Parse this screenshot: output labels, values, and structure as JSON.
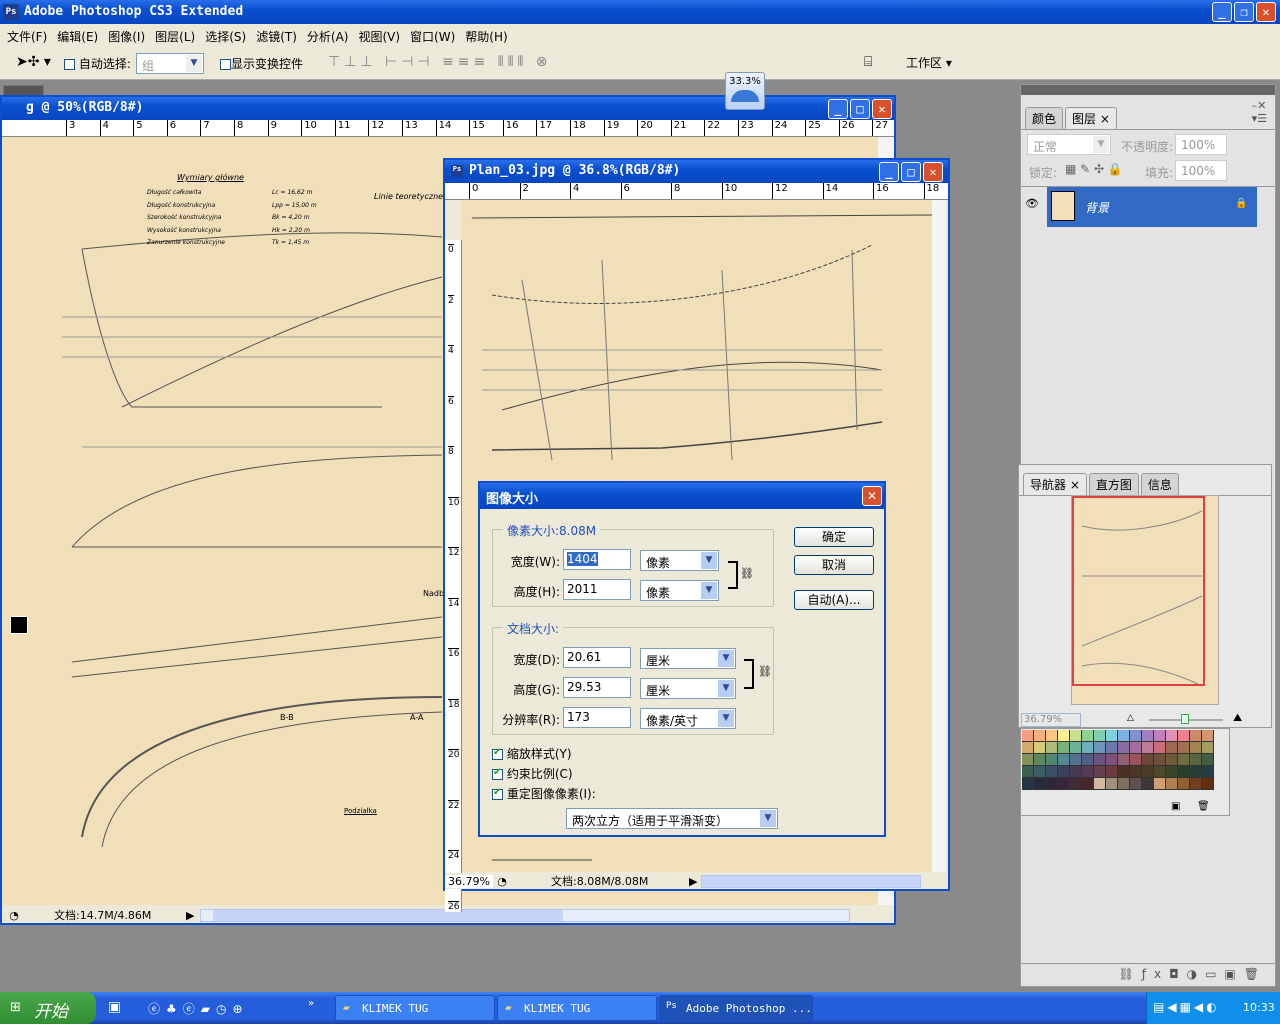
{
  "app": {
    "title": "Adobe Photoshop CS3 Extended",
    "ps_badge": "Ps"
  },
  "menu": [
    "文件(F)",
    "编辑(E)",
    "图像(I)",
    "图层(L)",
    "选择(S)",
    "滤镜(T)",
    "分析(A)",
    "视图(V)",
    "窗口(W)",
    "帮助(H)"
  ],
  "options": {
    "auto_select": "自动选择:",
    "auto_select_checked": false,
    "group_value": "组",
    "show_transform": "显示变换控件",
    "show_transform_checked": false,
    "workspace": "工作区 ▾",
    "zoom_popup": "33.3%"
  },
  "back_doc": {
    "title": "g @ 50%(RGB/8#)",
    "ruler": [
      "3",
      "4",
      "5",
      "6",
      "7",
      "8",
      "9",
      "10",
      "11",
      "12",
      "13",
      "14",
      "15",
      "16",
      "17",
      "18",
      "19",
      "20",
      "21",
      "22",
      "23",
      "24",
      "25",
      "26",
      "27"
    ],
    "status": "文档:14.7M/4.86M",
    "drawing_text": [
      "Wymiary główne",
      "Długość całkowita",
      "Długość konstrukcyjna",
      "Szerokość konstrukcyjna",
      "Wysokość konstrukcyjna",
      "Zanurzenie konstrukcyjne",
      "Lc = 16,62 m",
      "Lpp = 15,00 m",
      "Bk = 4,20 m",
      "Hk = 2,20 m",
      "Tk = 1,45 m",
      "Linie teoretyczne",
      "B-B",
      "A-A",
      "Podziałka",
      "Nadb"
    ]
  },
  "front_doc": {
    "title": "Plan_03.jpg @ 36.8%(RGB/8#)",
    "ruler": [
      "0",
      "2",
      "4",
      "6",
      "8",
      "10",
      "12",
      "14",
      "16",
      "18"
    ],
    "vruler": [
      "0",
      "2",
      "4",
      "6",
      "8",
      "10",
      "12",
      "14",
      "16",
      "18",
      "20",
      "22",
      "24",
      "26"
    ],
    "zoom": "36.79%",
    "status": "文档:8.08M/8.08M"
  },
  "dialog": {
    "title": "图像大小",
    "pixel_group": "像素大小:8.08M",
    "width_label": "宽度(W):",
    "width_value": "1404",
    "width_unit": "像素",
    "height_label": "高度(H):",
    "height_value": "2011",
    "height_unit": "像素",
    "doc_group": "文档大小:",
    "doc_width_label": "宽度(D):",
    "doc_width_value": "20.61",
    "doc_width_unit": "厘米",
    "doc_height_label": "高度(G):",
    "doc_height_value": "29.53",
    "doc_height_unit": "厘米",
    "resolution_label": "分辨率(R):",
    "resolution_value": "173",
    "resolution_unit": "像素/英寸",
    "scale_styles": "缩放样式(Y)",
    "scale_styles_checked": true,
    "constrain": "约束比例(C)",
    "constrain_checked": true,
    "resample": "重定图像像素(I):",
    "resample_checked": true,
    "resample_method": "两次立方（适用于平滑渐变）",
    "ok": "确定",
    "cancel": "取消",
    "auto": "自动(A)..."
  },
  "layers_panel": {
    "tabs": [
      "颜色",
      "图层"
    ],
    "blend_mode": "正常",
    "opacity_label": "不透明度:",
    "opacity": "100%",
    "lock_label": "锁定:",
    "fill_label": "填充:",
    "fill": "100%",
    "layers": [
      {
        "name": "背景",
        "visible": true,
        "locked": true,
        "selected": true
      }
    ]
  },
  "navigator": {
    "tabs": [
      "导航器",
      "直方图",
      "信息"
    ],
    "zoom": "36.79%",
    "slider_fraction": 0.45
  },
  "taskbar": {
    "start": "开始",
    "tasks": [
      "KLIMEK TUG",
      "KLIMEK TUG",
      "Adobe Photoshop ..."
    ],
    "clock": "10:33"
  },
  "colors": {
    "xp_blue": "#0a4fd0",
    "canvas": "#f1dfb9",
    "selection": "#316ac5",
    "nav_box": "#e04040"
  }
}
